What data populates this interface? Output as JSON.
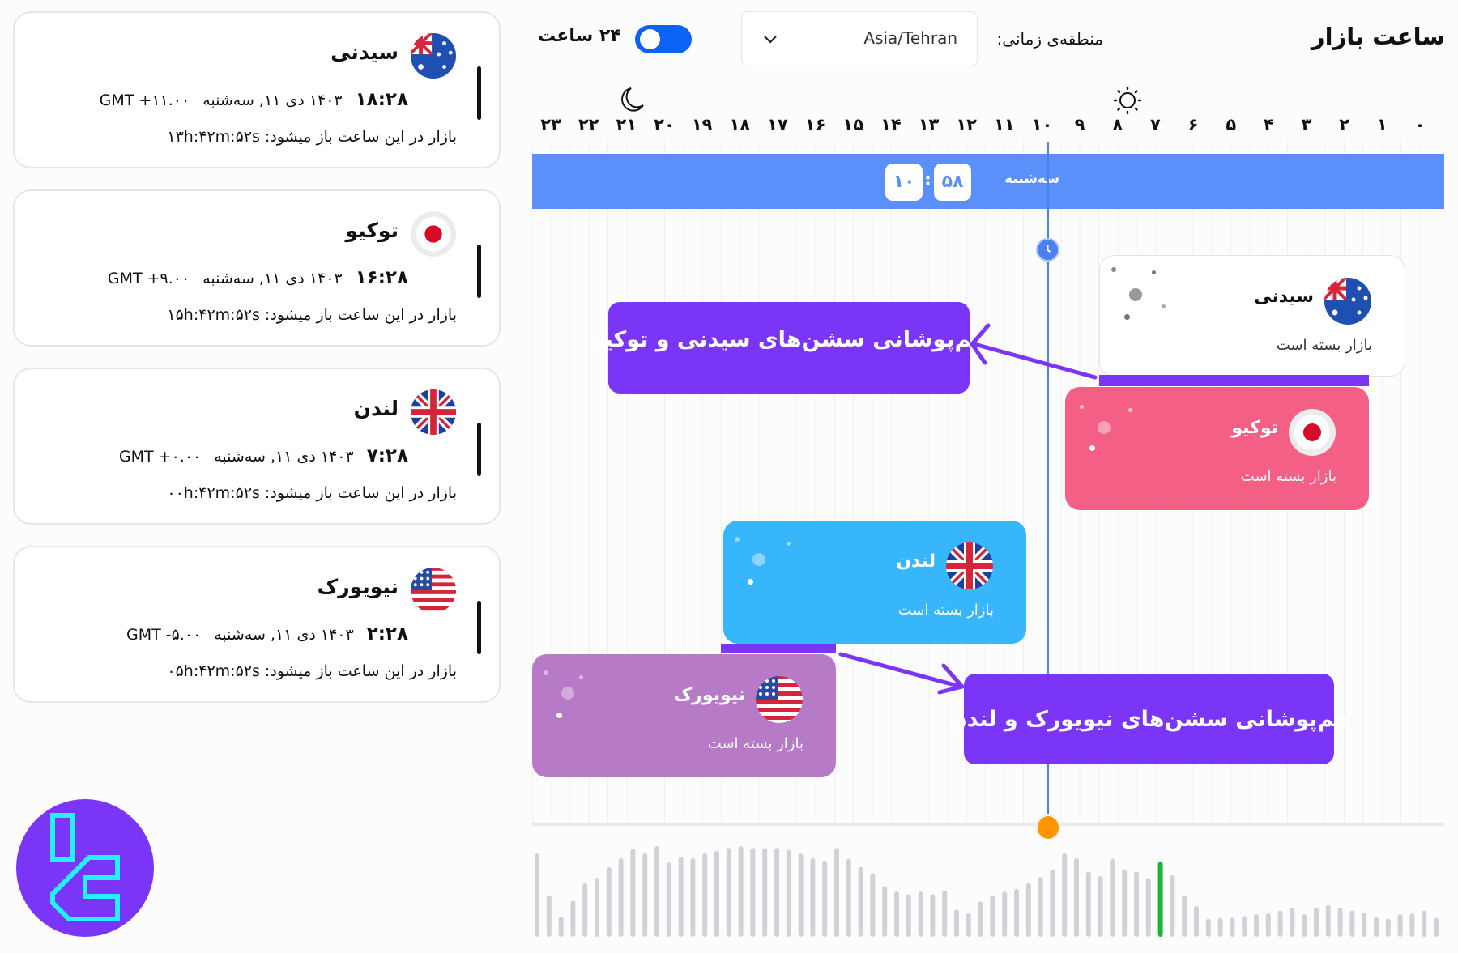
{
  "header": {
    "title": "ساعت بازار",
    "timezone_label": "منطقه‌ی زمانی:",
    "timezone_value": "Asia/Tehran",
    "toggle_label": "۲۴ ساعت",
    "toggle_on": true
  },
  "cards": [
    {
      "name": "سیدنی",
      "flag": "australia-flag",
      "time": "۱۸:۲۸",
      "date": "۱۴۰۳ دی ۱۱, سه‌شنبه",
      "gmt": "GMT +۱۱.۰۰",
      "open_label": "بازار در این ساعت باز میشود:",
      "countdown": "۱۳h:۴۲m:۵۲s"
    },
    {
      "name": "توکیو",
      "flag": "japan-flag",
      "time": "۱۶:۲۸",
      "date": "۱۴۰۳ دی ۱۱, سه‌شنبه",
      "gmt": "GMT +۹.۰۰",
      "open_label": "بازار در این ساعت باز میشود:",
      "countdown": "۱۵h:۴۲m:۵۲s"
    },
    {
      "name": "لندن",
      "flag": "uk-flag",
      "time": "۷:۲۸",
      "date": "۱۴۰۳ دی ۱۱, سه‌شنبه",
      "gmt": "GMT +۰.۰۰",
      "open_label": "بازار در این ساعت باز میشود:",
      "countdown": "۰۰h:۴۲m:۵۲s"
    },
    {
      "name": "نیویورک",
      "flag": "us-flag",
      "time": "۲:۲۸",
      "date": "۱۴۰۳ دی ۱۱, سه‌شنبه",
      "gmt": "GMT -۵.۰۰",
      "open_label": "بازار در این ساعت باز میشود:",
      "countdown": "۰۵h:۴۲m:۵۲s"
    }
  ],
  "timeline": {
    "hours": [
      "۰",
      "۱",
      "۲",
      "۳",
      "۴",
      "۵",
      "۶",
      "۷",
      "۸",
      "۹",
      "۱۰",
      "۱۱",
      "۱۲",
      "۱۳",
      "۱۴",
      "۱۵",
      "۱۶",
      "۱۷",
      "۱۸",
      "۱۹",
      "۲۰",
      "۲۱",
      "۲۲",
      "۲۳"
    ],
    "day": "سه‌شنبه",
    "current_hour": "۱۰",
    "current_minute": "۵۸",
    "colon": ":",
    "band_color": "#5b8ff9",
    "now_line_color": "#4a80f0"
  },
  "sessions": [
    {
      "name": "سیدنی",
      "status": "بازار بسته است",
      "color": "#ffffff",
      "flag": "australia-flag"
    },
    {
      "name": "توکیو",
      "status": "بازار بسته است",
      "color": "#f45f86",
      "flag": "japan-flag"
    },
    {
      "name": "لندن",
      "status": "بازار بسته است",
      "color": "#38b6fb",
      "flag": "uk-flag"
    },
    {
      "name": "نیویورک",
      "status": "بازار بسته است",
      "color": "#b77ac6",
      "flag": "us-flag"
    }
  ],
  "callouts": {
    "sydney_tokyo": "هم‌پوشانی سشن‌های سیدنی و توکیو",
    "newyork_london": "هم‌پوشانی سشن‌های نیویورک و لندن",
    "color": "#7b35f7"
  },
  "activity_bars": {
    "values": [
      92,
      46,
      22,
      40,
      59,
      65,
      77,
      87,
      97,
      92,
      100,
      82,
      88,
      87,
      92,
      95,
      98,
      100,
      98,
      98,
      98,
      96,
      92,
      87,
      84,
      98,
      86,
      77,
      70,
      56,
      50,
      47,
      50,
      47,
      51,
      30,
      26,
      39,
      46,
      50,
      53,
      59,
      66,
      74,
      92,
      87,
      72,
      67,
      86,
      74,
      72,
      65,
      83,
      68,
      46,
      34,
      20,
      21,
      21,
      23,
      25,
      26,
      29,
      32,
      25,
      32,
      35,
      32,
      29,
      27,
      22,
      20,
      25,
      26,
      29,
      21
    ],
    "highlight_index": 52,
    "bar_color": "#cfd2d6",
    "highlight_color": "#1db335",
    "slider_color": "#ff9500"
  },
  "logo": {
    "color": "#7b35f7",
    "accent": "#22f2ff"
  }
}
